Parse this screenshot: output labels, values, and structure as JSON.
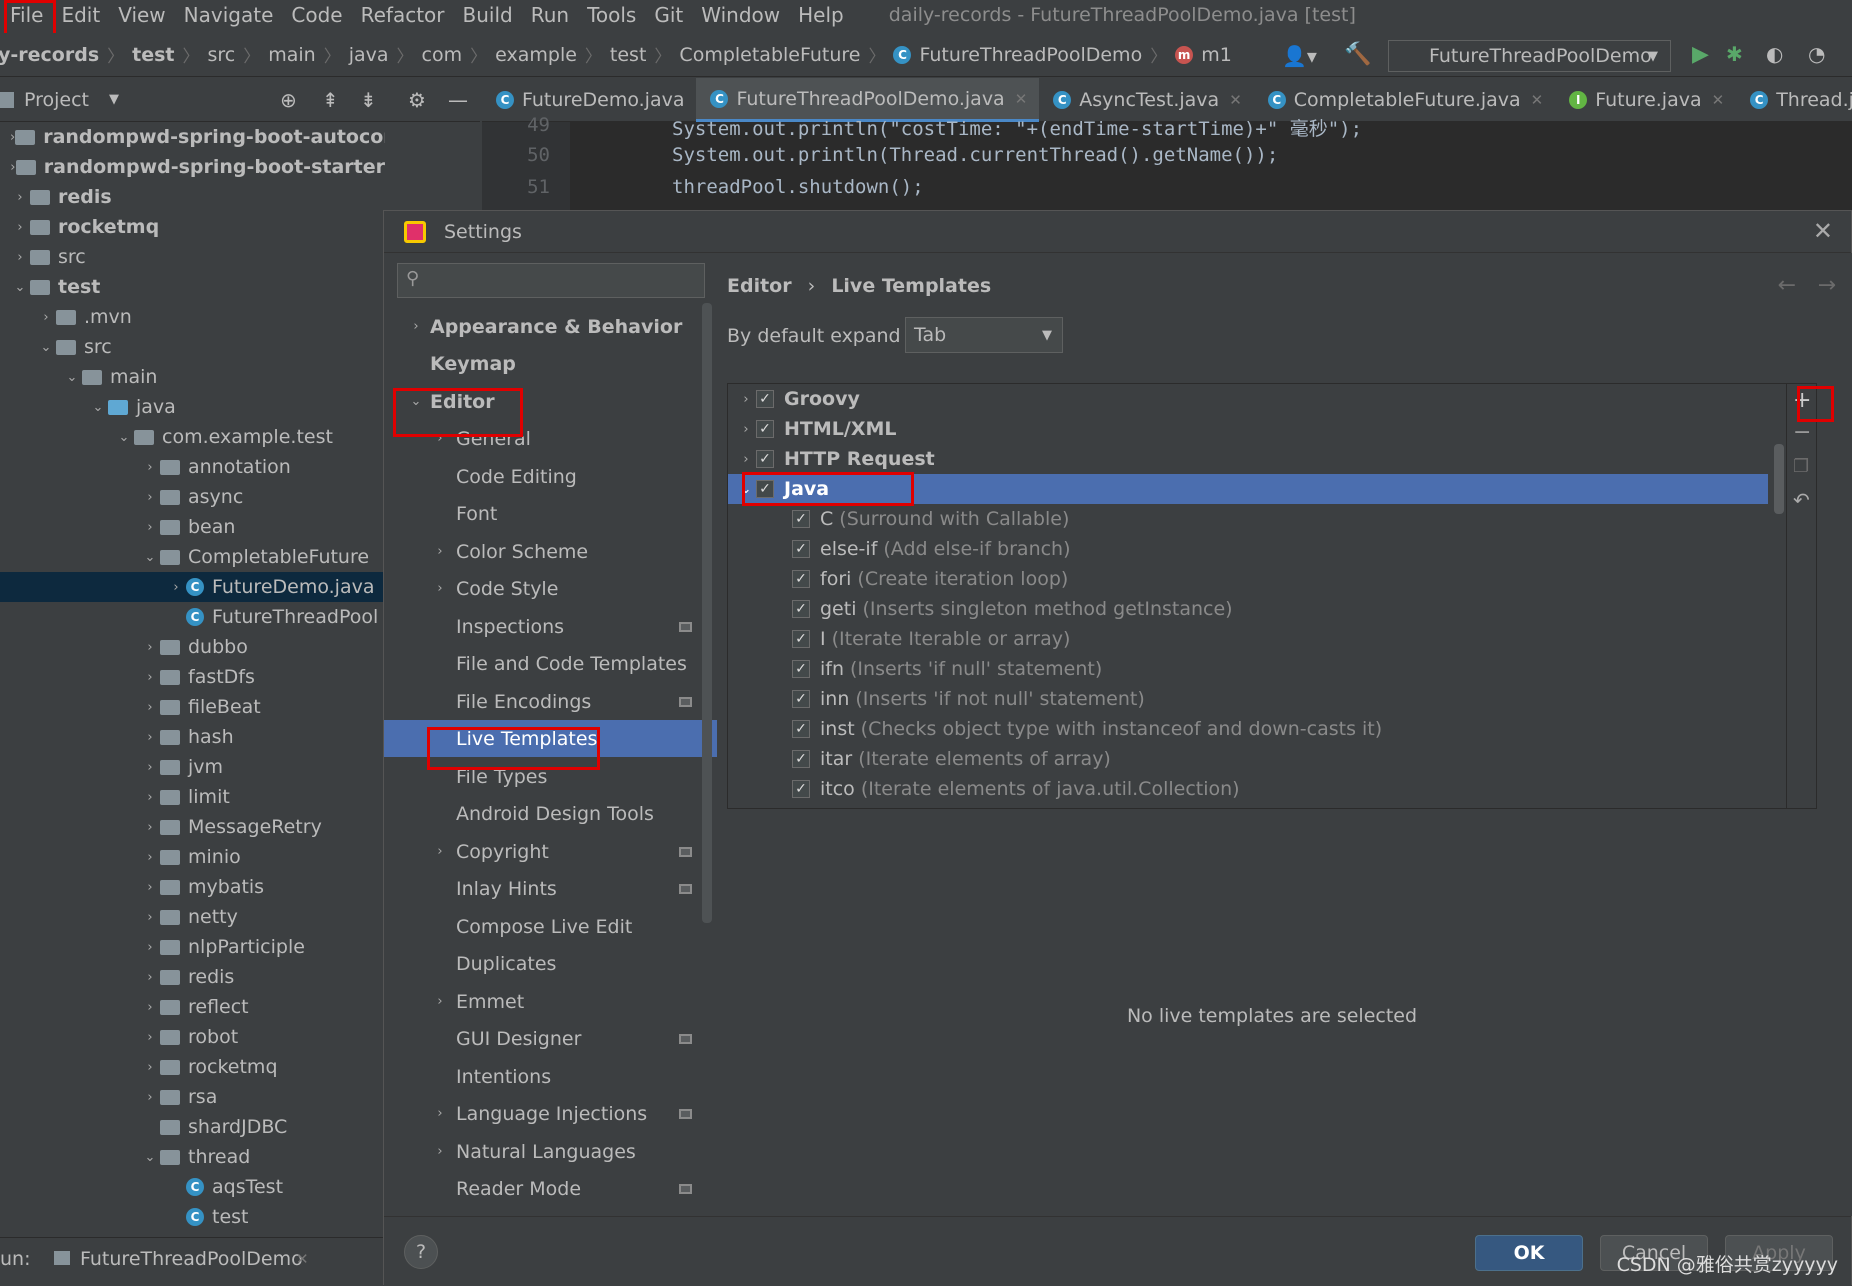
{
  "menubar": {
    "items": [
      "File",
      "Edit",
      "View",
      "Navigate",
      "Code",
      "Refactor",
      "Build",
      "Run",
      "Tools",
      "Git",
      "Window",
      "Help"
    ],
    "title": "daily-records - FutureThreadPoolDemo.java [test]"
  },
  "breadcrumb": [
    "y-records",
    "test",
    "src",
    "main",
    "java",
    "com",
    "example",
    "test",
    "CompletableFuture",
    "FutureThreadPoolDemo",
    "m1"
  ],
  "run_config": "FutureThreadPoolDemo",
  "project_panel": {
    "title": "Project"
  },
  "editor_tabs": [
    {
      "label": "FutureDemo.java"
    },
    {
      "label": "FutureThreadPoolDemo.java"
    },
    {
      "label": "AsyncTest.java"
    },
    {
      "label": "CompletableFuture.java"
    },
    {
      "label": "Future.java"
    },
    {
      "label": "Thread.java"
    }
  ],
  "code": {
    "line_numbers": [
      "49",
      "50",
      "51"
    ],
    "lines": [
      "System.out.println(\"costTime: \"+(endTime-startTime)+\" 毫秒\");",
      "System.out.println(Thread.currentThread().getName());",
      "threadPool.shutdown();"
    ]
  },
  "tree": [
    {
      "label": "randompwd-spring-boot-autoconfigure"
    },
    {
      "label": "randompwd-spring-boot-starter"
    },
    {
      "label": "redis"
    },
    {
      "label": "rocketmq"
    },
    {
      "label": "src"
    },
    {
      "label": "test"
    },
    {
      "label": ".mvn"
    },
    {
      "label": "src"
    },
    {
      "label": "main"
    },
    {
      "label": "java"
    },
    {
      "label": "com.example.test"
    },
    {
      "label": "annotation"
    },
    {
      "label": "async"
    },
    {
      "label": "bean"
    },
    {
      "label": "CompletableFuture"
    },
    {
      "label": "FutureDemo.java"
    },
    {
      "label": "FutureThreadPool"
    },
    {
      "label": "dubbo"
    },
    {
      "label": "fastDfs"
    },
    {
      "label": "fileBeat"
    },
    {
      "label": "hash"
    },
    {
      "label": "jvm"
    },
    {
      "label": "limit"
    },
    {
      "label": "MessageRetry"
    },
    {
      "label": "minio"
    },
    {
      "label": "mybatis"
    },
    {
      "label": "netty"
    },
    {
      "label": "nlpParticiple"
    },
    {
      "label": "redis"
    },
    {
      "label": "reflect"
    },
    {
      "label": "robot"
    },
    {
      "label": "rocketmq"
    },
    {
      "label": "rsa"
    },
    {
      "label": "shardJDBC"
    },
    {
      "label": "thread"
    },
    {
      "label": "aqsTest"
    },
    {
      "label": "test"
    }
  ],
  "run_bar": {
    "prefix": "un:",
    "config": "FutureThreadPoolDemo"
  },
  "dialog": {
    "title": "Settings",
    "breadcrumb": {
      "parent": "Editor",
      "current": "Live Templates"
    },
    "expand_label": "By default expand with",
    "expand_value": "Tab",
    "settings_tree": [
      {
        "label": "Appearance & Behavior"
      },
      {
        "label": "Keymap"
      },
      {
        "label": "Editor"
      },
      {
        "label": "General"
      },
      {
        "label": "Code Editing"
      },
      {
        "label": "Font"
      },
      {
        "label": "Color Scheme"
      },
      {
        "label": "Code Style"
      },
      {
        "label": "Inspections"
      },
      {
        "label": "File and Code Templates"
      },
      {
        "label": "File Encodings"
      },
      {
        "label": "Live Templates"
      },
      {
        "label": "File Types"
      },
      {
        "label": "Android Design Tools"
      },
      {
        "label": "Copyright"
      },
      {
        "label": "Inlay Hints"
      },
      {
        "label": "Compose Live Edit"
      },
      {
        "label": "Duplicates"
      },
      {
        "label": "Emmet"
      },
      {
        "label": "GUI Designer"
      },
      {
        "label": "Intentions"
      },
      {
        "label": "Language Injections"
      },
      {
        "label": "Natural Languages"
      },
      {
        "label": "Reader Mode"
      }
    ],
    "template_groups": [
      {
        "name": "Groovy"
      },
      {
        "name": "HTML/XML"
      },
      {
        "name": "HTTP Request"
      },
      {
        "name": "Java"
      }
    ],
    "java_templates": [
      {
        "abbr": "C",
        "desc": "(Surround with Callable)"
      },
      {
        "abbr": "else-if",
        "desc": "(Add else-if branch)"
      },
      {
        "abbr": "fori",
        "desc": "(Create iteration loop)"
      },
      {
        "abbr": "geti",
        "desc": "(Inserts singleton method getInstance)"
      },
      {
        "abbr": "I",
        "desc": "(Iterate Iterable or array)"
      },
      {
        "abbr": "ifn",
        "desc": "(Inserts 'if null' statement)"
      },
      {
        "abbr": "inn",
        "desc": "(Inserts 'if not null' statement)"
      },
      {
        "abbr": "inst",
        "desc": "(Checks object type with instanceof and down-casts it)"
      },
      {
        "abbr": "itar",
        "desc": "(Iterate elements of array)"
      },
      {
        "abbr": "itco",
        "desc": "(Iterate elements of java.util.Collection)"
      }
    ],
    "empty_text": "No live templates are selected",
    "buttons": {
      "ok": "OK",
      "cancel": "Cancel",
      "apply": "Apply"
    },
    "help": "?"
  },
  "watermark": "CSDN @雅俗共赏zyyyyy",
  "colors": {
    "accent": "#4b6eaf",
    "highlight": "#e00000"
  }
}
